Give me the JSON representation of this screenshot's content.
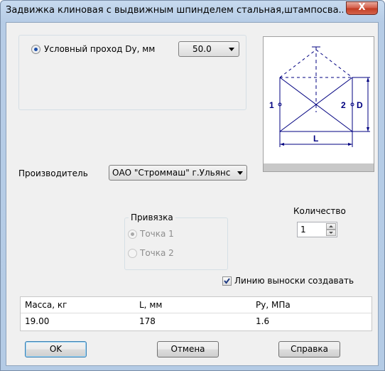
{
  "window": {
    "title": "Задвижка клиновая с выдвижным шпинделем стальная,штампосва...",
    "close_label": "X"
  },
  "diameter": {
    "radio_label": "Условный проход Dy, мм",
    "selected": true,
    "value": "50.0"
  },
  "diagram": {
    "labels": {
      "left": "1",
      "right": "2",
      "height": "D",
      "length": "L"
    }
  },
  "manufacturer": {
    "label": "Производитель",
    "value": "ОАО \"Строммаш\" г.Ульянс"
  },
  "binding": {
    "group_label": "Привязка",
    "options": [
      {
        "label": "Точка 1",
        "selected": true,
        "enabled": false
      },
      {
        "label": "Точка 2",
        "selected": false,
        "enabled": false
      }
    ]
  },
  "quantity": {
    "label": "Количество",
    "value": "1"
  },
  "leader_line": {
    "label": "Линию выноски создавать",
    "checked": true
  },
  "properties_table": {
    "headers": [
      "Масса, кг",
      "L, мм",
      "Py, МПа"
    ],
    "rows": [
      [
        "19.00",
        "178",
        "1.6"
      ]
    ]
  },
  "buttons": {
    "ok": "OK",
    "cancel": "Отмена",
    "help": "Справка"
  },
  "colors": {
    "diagram_line": "#000080",
    "checkbox_check": "#1f3b82",
    "close_button": "#c13b22"
  }
}
